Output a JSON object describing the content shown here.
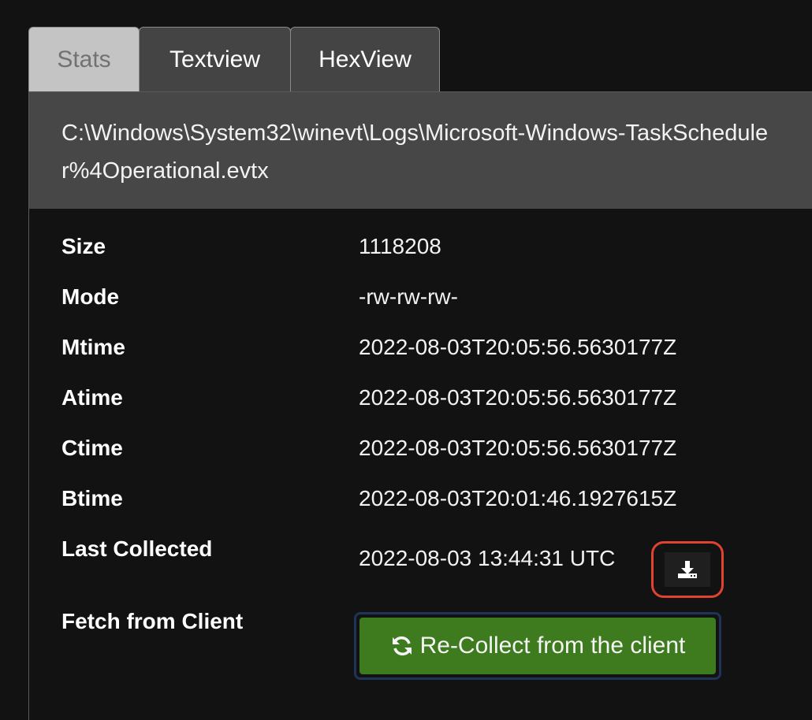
{
  "tabs": {
    "stats": "Stats",
    "textview": "Textview",
    "hexview": "HexView",
    "active": "stats"
  },
  "file": {
    "path": "C:\\Windows\\System32\\winevt\\Logs\\Microsoft-Windows-TaskScheduler%4Operational.evtx"
  },
  "stats": {
    "size_label": "Size",
    "size_value": "1118208",
    "mode_label": "Mode",
    "mode_value": "-rw-rw-rw-",
    "mtime_label": "Mtime",
    "mtime_value": "2022-08-03T20:05:56.5630177Z",
    "atime_label": "Atime",
    "atime_value": "2022-08-03T20:05:56.5630177Z",
    "ctime_label": "Ctime",
    "ctime_value": "2022-08-03T20:05:56.5630177Z",
    "btime_label": "Btime",
    "btime_value": "2022-08-03T20:01:46.1927615Z",
    "last_collected_label": "Last Collected",
    "last_collected_value": "2022-08-03 13:44:31 UTC",
    "fetch_label": "Fetch from Client"
  },
  "actions": {
    "download_icon": "download-icon",
    "recollect_label": "Re-Collect from the client",
    "recollect_icon": "refresh-icon"
  },
  "colors": {
    "recollect_bg": "#3e7a1e",
    "highlight": "#e0432f",
    "path_bar_bg": "#474747"
  }
}
